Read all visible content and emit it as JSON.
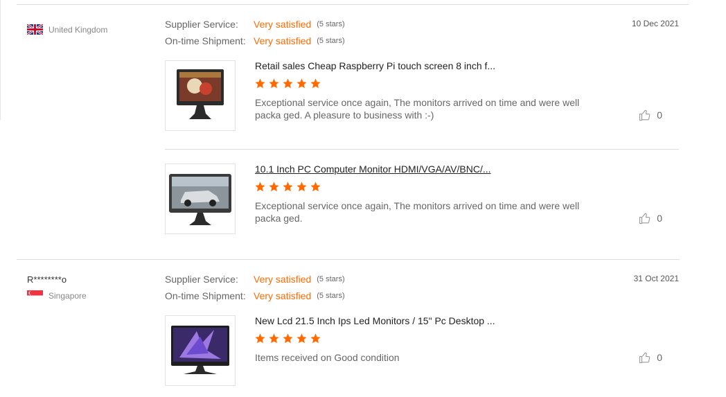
{
  "reviews": [
    {
      "author": "",
      "country": "United Kingdom",
      "flag": "uk-flag",
      "date": "10 Dec 2021",
      "ratings": [
        {
          "label": "Supplier Service:",
          "value": "Very satisfied",
          "stars": "(5 stars)"
        },
        {
          "label": "On-time Shipment:",
          "value": "Very satisfied",
          "stars": "(5 stars)"
        }
      ],
      "items": [
        {
          "title": "Retail sales Cheap Raspberry Pi touch screen 8 inch f...",
          "rating": 5,
          "comment": "Exceptional service once again, The monitors arrived on time and were well packa ged. A pleasure to business with :-)",
          "likes": "0",
          "image": "monitor-food-thumbnail"
        },
        {
          "title": "10.1 Inch PC Computer Monitor HDMI/VGA/AV/BNC/...",
          "rating": 5,
          "comment": "Exceptional service once again, The monitors arrived on time and were well packa ged.",
          "likes": "0",
          "image": "monitor-car-thumbnail"
        }
      ]
    },
    {
      "author": "R********o",
      "country": "Singapore",
      "flag": "singapore-flag",
      "date": "31 Oct 2021",
      "ratings": [
        {
          "label": "Supplier Service:",
          "value": "Very satisfied",
          "stars": "(5 stars)"
        },
        {
          "label": "On-time Shipment:",
          "value": "Very satisfied",
          "stars": "(5 stars)"
        }
      ],
      "items": [
        {
          "title": "New Lcd 21.5 Inch Ips Led Monitors / 15\" Pc Desktop ...",
          "rating": 5,
          "comment": "Items received on Good condition",
          "likes": "0",
          "image": "monitor-purple-thumbnail"
        }
      ]
    }
  ],
  "colors": {
    "accent": "#ff6a00",
    "divider": "#dcdcdc",
    "muted": "#666666"
  }
}
